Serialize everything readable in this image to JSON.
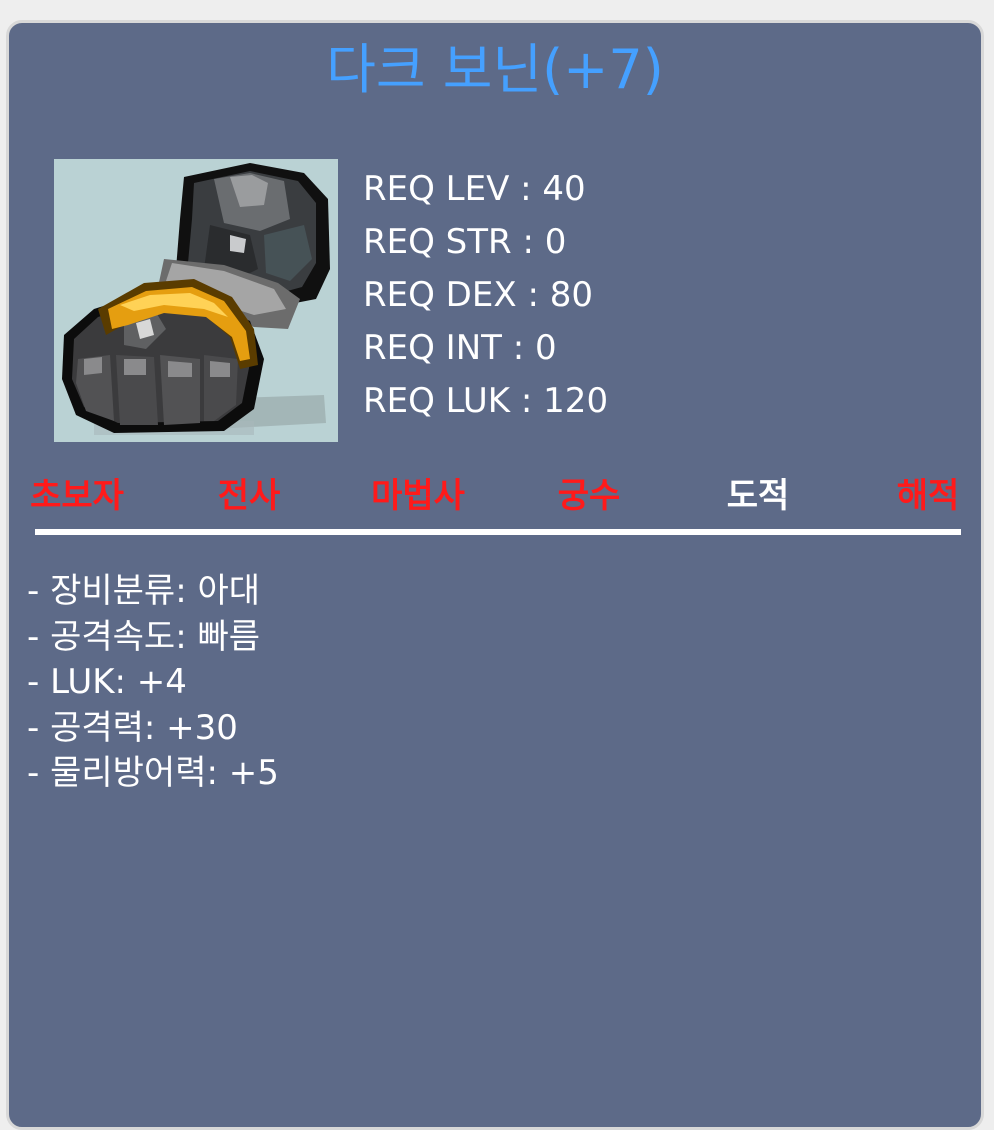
{
  "item": {
    "name": "다크 보닌(+7)",
    "icon": "dark-gauntlet-icon",
    "title_color": "#45a0ff"
  },
  "requirements": [
    {
      "label": "REQ LEV",
      "value": "40",
      "text": "REQ LEV : 40"
    },
    {
      "label": "REQ STR",
      "value": "0",
      "text": "REQ STR : 0"
    },
    {
      "label": "REQ DEX",
      "value": "80",
      "text": "REQ DEX : 80"
    },
    {
      "label": "REQ INT",
      "value": "0",
      "text": "REQ INT : 0"
    },
    {
      "label": "REQ LUK",
      "value": "120",
      "text": "REQ LUK : 120"
    }
  ],
  "jobs": [
    {
      "name": "초보자",
      "color": "#ff1a1a",
      "equippable": false
    },
    {
      "name": "전사",
      "color": "#ff1a1a",
      "equippable": false
    },
    {
      "name": "마법사",
      "color": "#ff1a1a",
      "equippable": false
    },
    {
      "name": "궁수",
      "color": "#ff1a1a",
      "equippable": false
    },
    {
      "name": "도적",
      "color": "#ffffff",
      "equippable": true
    },
    {
      "name": "해적",
      "color": "#ff1a1a",
      "equippable": false
    }
  ],
  "stats": [
    "- 장비분류: 아대",
    "- 공격속도: 빠름",
    "- LUK: +4",
    "- 공격력: +30",
    "- 물리방어력: +5"
  ],
  "colors": {
    "panel_background": "#5d6a88",
    "icon_background": "#bad2d4",
    "text": "#ffffff",
    "unavailable_job": "#ff1a1a"
  }
}
